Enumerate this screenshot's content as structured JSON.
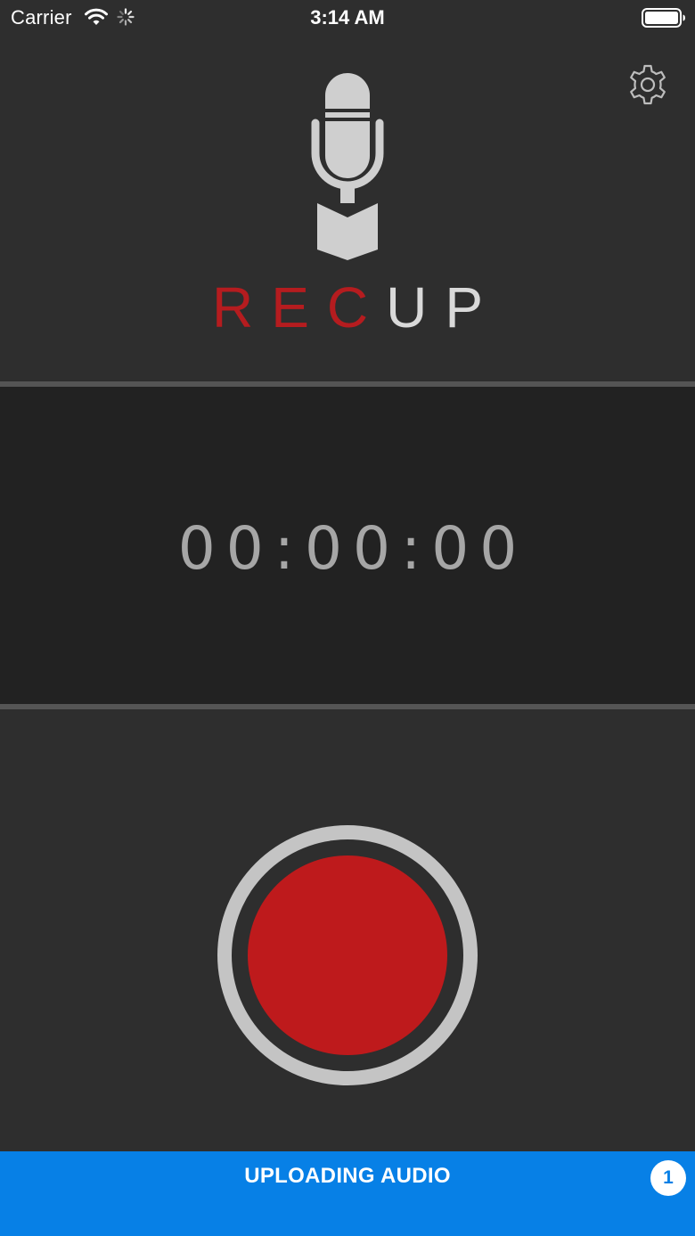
{
  "status_bar": {
    "carrier": "Carrier",
    "time": "3:14 AM",
    "icons": [
      "wifi-icon",
      "activity-spinner-icon",
      "battery-icon"
    ]
  },
  "header": {
    "settings_icon": "gear-icon",
    "logo_icon": "microphone-icon",
    "brand_rec": "REC",
    "brand_up": "UP"
  },
  "timer": {
    "value": "00:00:00"
  },
  "record": {
    "icon": "record-icon"
  },
  "upload": {
    "label": "UPLOADING AUDIO",
    "count": "1"
  },
  "colors": {
    "background": "#2e2e2e",
    "timer_panel": "#222222",
    "accent_red": "#be1a1c",
    "brand_red": "#b51c1f",
    "banner_blue": "#0780e6",
    "light_gray": "#c4c4c4"
  }
}
